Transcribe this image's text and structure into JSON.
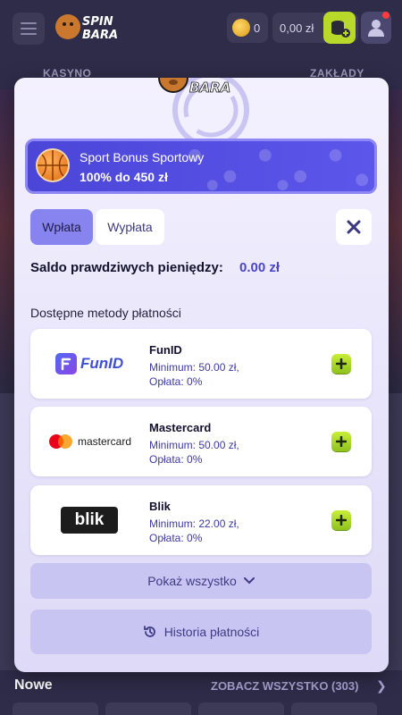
{
  "header": {
    "logo_text": "SPIN BARA",
    "coins": "0",
    "balance": "0,00 zł",
    "nav": [
      "KASYNO",
      "ZAKŁADY"
    ]
  },
  "modal": {
    "logo_text": "SPIN BARA",
    "bonus": {
      "title": "Sport Bonus Sportowy",
      "description": "100% do 450 zł"
    },
    "tabs": [
      {
        "label": "Wpłata",
        "active": true
      },
      {
        "label": "Wypłata",
        "active": false
      }
    ],
    "balance": {
      "label": "Saldo prawdziwych pieniędzy:",
      "value": "0.00 zł"
    },
    "methods_title": "Dostępne metody płatności",
    "methods": [
      {
        "name": "FunID",
        "minimum": "Minimum: 50.00 zł,",
        "fee": "Opłata: 0%",
        "logo_text": "FunID",
        "icon": "funid-logo"
      },
      {
        "name": "Mastercard",
        "minimum": "Minimum: 50.00 zł,",
        "fee": "Opłata: 0%",
        "logo_text": "mastercard",
        "icon": "mastercard-logo"
      },
      {
        "name": "Blik",
        "minimum": "Minimum: 22.00 zł,",
        "fee": "Opłata: 0%",
        "logo_text": "blik",
        "icon": "blik-logo"
      }
    ],
    "show_all_label": "Pokaż wszystko",
    "history_label": "Historia płatności"
  },
  "footer": {
    "section_title": "Nowe",
    "see_all_label": "ZOBACZ WSZYSTKO (303)"
  },
  "colors": {
    "accent": "#4b45d8",
    "tab_active": "#8784f0",
    "add_button": "#a8d828",
    "balance_value": "#4a46c8"
  }
}
